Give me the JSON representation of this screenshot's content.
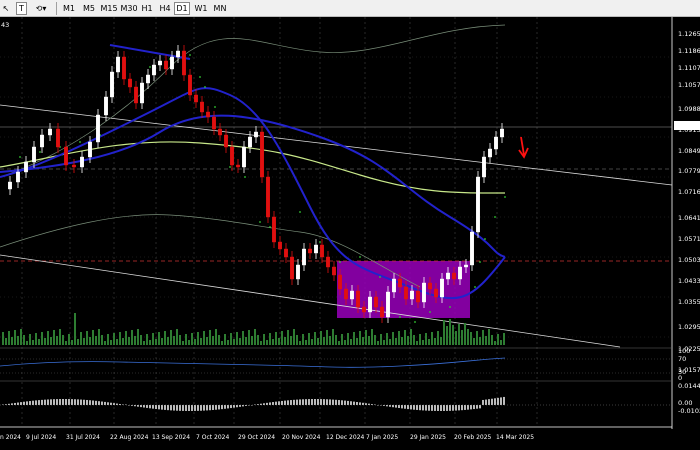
{
  "toolbar": {
    "tools": [
      {
        "name": "cursor-icon",
        "glyph": "↖"
      },
      {
        "name": "crosshair-icon",
        "glyph": "┼"
      },
      {
        "name": "vertical-line-icon",
        "glyph": "│"
      },
      {
        "name": "horizontal-line-icon",
        "glyph": "─"
      },
      {
        "name": "trendline-icon",
        "glyph": "╱"
      },
      {
        "name": "text-tool-icon",
        "glyph": "T"
      },
      {
        "name": "shapes-icon",
        "glyph": "⟲▾"
      }
    ],
    "timeframes": [
      "M1",
      "M5",
      "M15",
      "M30",
      "H1",
      "H4",
      "D1",
      "W1",
      "MN"
    ],
    "active_timeframe": "D1"
  },
  "chart": {
    "corner_label": "43",
    "price_labels": [
      "1.12650",
      "1.11860",
      "1.11070",
      "1.10570",
      "1.09880",
      "1.09150",
      "1.08490",
      "1.07790",
      "1.07160",
      "1.06410",
      "1.05710",
      "1.05030",
      "1.04330",
      "1.03550",
      "1.02950",
      "1.02250",
      "1.01570"
    ],
    "current_price_badge": "1.09343",
    "date_labels": [
      "n 2024",
      "9 Jul 2024",
      "31 Jul 2024",
      "22 Aug 2024",
      "13 Sep 2024",
      "7 Oct 2024",
      "29 Oct 2024",
      "20 Nov 2024",
      "12 Dec 2024",
      "7 Jan 2025",
      "29 Jan 2025",
      "20 Feb 2025",
      "14 Mar 2025"
    ],
    "rsi_labels": [
      "100",
      "70",
      "30",
      "0"
    ],
    "macd_labels": [
      "0.01449",
      "0.00",
      "-0.0102"
    ],
    "colors": {
      "background": "#000000",
      "bull_candle": "#ffffff",
      "bear_candle": "#e01010",
      "ma_blue": "#2222cc",
      "ma_lime": "#c8e88a",
      "parabolic_sar": "#33cc33",
      "volume": "#2e7d32",
      "consolidation_box": "#9900bb",
      "rsi_line": "#3a6fd8",
      "arrow": "#ff1111"
    },
    "icons": [
      "down-arrow-icon"
    ]
  }
}
